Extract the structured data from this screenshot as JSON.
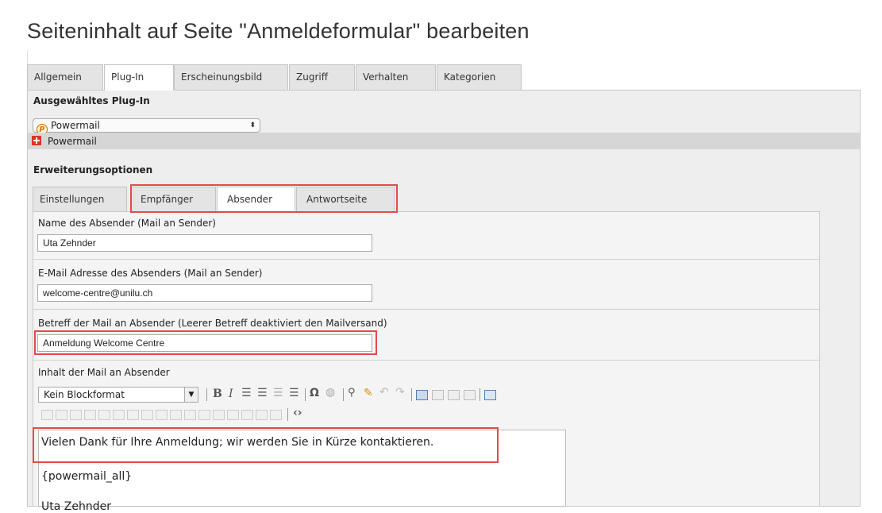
{
  "page_title": "Seiteninhalt auf Seite \"Anmeldeformular\" bearbeiten",
  "outer_tabs": [
    "Allgemein",
    "Plug-In",
    "Erscheinungsbild",
    "Zugriff",
    "Verhalten",
    "Kategorien"
  ],
  "outer_active": "Plug-In",
  "plugin": {
    "heading": "Ausgewähltes Plug-In",
    "selected": "Powermail",
    "bar_label": "Powermail"
  },
  "ext_heading": "Erweiterungsoptionen",
  "inner_tabs": [
    "Einstellungen",
    "Empfänger",
    "Absender",
    "Antwortseite"
  ],
  "inner_active": "Absender",
  "fields": {
    "sender_name_label": "Name des Absender (Mail an Sender)",
    "sender_name_value": "Uta Zehnder",
    "sender_email_label": "E-Mail Adresse des Absenders (Mail an Sender)",
    "sender_email_value": "welcome-centre@unilu.ch",
    "subject_label": "Betreff der Mail an Absender (Leerer Betreff deaktiviert den Mailversand)",
    "subject_value": "Anmeldung Welcome Centre",
    "body_label": "Inhalt der Mail an Absender"
  },
  "editor": {
    "block_format": "Kein Blockformat",
    "lines": [
      "Vielen Dank für Ihre Anmeldung; wir werden Sie in Kürze kontaktieren.",
      "{powermail_all}",
      "Uta Zehnder"
    ]
  },
  "colors": {
    "highlight": "#e24a4a",
    "tab_bg": "#e4e4e4",
    "panel_bg": "#eeeeee"
  }
}
